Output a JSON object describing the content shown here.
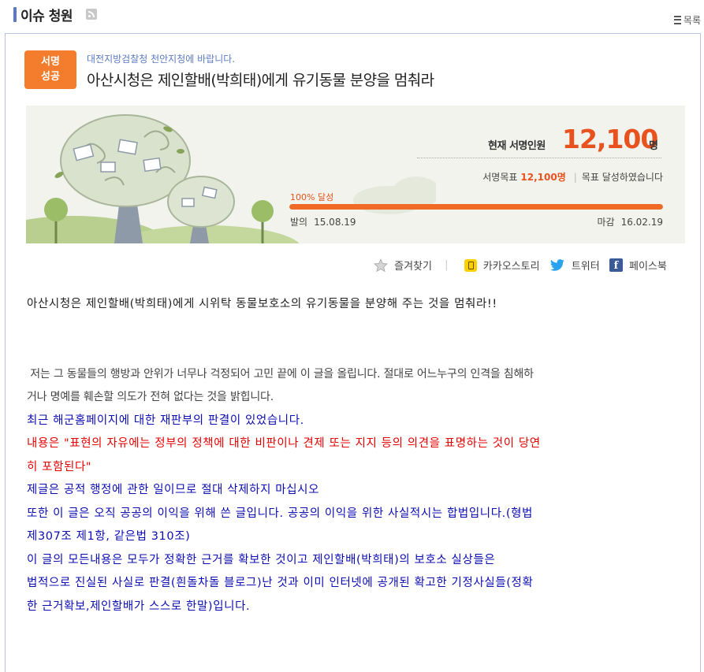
{
  "header": {
    "title": "이슈 청원",
    "list_label": "목록"
  },
  "petition": {
    "status_line1": "서명",
    "status_line2": "성공",
    "addressee": "대전지방검찰청 천안지청에 바랍니다.",
    "title": "아산시청은 제인할배(박희태)에게 유기동물 분양을 멈춰라"
  },
  "stats": {
    "current_label": "현재 서명인원",
    "current_count": "12,100",
    "current_unit": "명",
    "goal_label": "서명목표",
    "goal_value": "12,100명",
    "goal_status": "목표 달성하였습니다",
    "progress_label": "100% 달성",
    "progress_fraction": 1.0,
    "start_label": "발의",
    "start_date": "15.08.19",
    "end_label": "마감",
    "end_date": "16.02.19"
  },
  "share": {
    "bookmark": "즐겨찾기",
    "kakao": "카카오스토리",
    "twitter": "트위터",
    "facebook": "페이스북"
  },
  "content": {
    "intro": "아산시청은 제인할배(박희태)에게 시위탁 동물보호소의 유기동물을 분양해 주는 것을 멈춰라!!",
    "p1_line1": " 저는 그 동물들의 행방과 안위가 너무나 걱정되어 고민 끝에 이 글을 올립니다. 절대로 어느누구의 인격을 침해하",
    "p1_line2": "거나 명예를 훼손할 의도가 전혀 없다는 것을 밝힙니다.",
    "blue1": "최근 해군홈페이지에 대한 재판부의 판결이 있었습니다.",
    "red1_line1": "내용은 \"표현의 자유에는 정부의 정책에 대한 비판이나 견제 또는 지지 등의 의견을 표명하는 것이 당연",
    "red1_line2": "히 포함된다\"",
    "blue2": "제글은 공적 행정에 관한 일이므로 절대 삭제하지 마십시오",
    "blue3_line1": "또한 이 글은 오직 공공의 이익을 위해 쓴 글입니다. 공공의 이익을 위한 사실적시는 합법입니다.(형법",
    "blue3_line2": "제307조 제1항, 같은법 310조)",
    "blue4": "이 글의 모든내용은 모두가 정확한 근거를 확보한 것이고 제인할배(박희태)의 보호소 실상들은",
    "blue5_line1": "법적으로 진실된 사실로 판결(흰돌차돌 블로그)난 것과 이미 인터넷에 공개된 확고한 기정사실들(정확",
    "blue5_line2": "한 근거확보,제인할배가 스스로 한말)입니다."
  },
  "colors": {
    "accent_orange": "#f37d2c",
    "count_orange": "#e8521f",
    "link_blue": "#5c7bc4",
    "text_blue": "#0c0cb3",
    "text_red": "#e60000"
  },
  "icons": [
    "rss-icon",
    "list-icon",
    "star-icon",
    "kakao-story-icon",
    "twitter-icon",
    "facebook-icon"
  ]
}
